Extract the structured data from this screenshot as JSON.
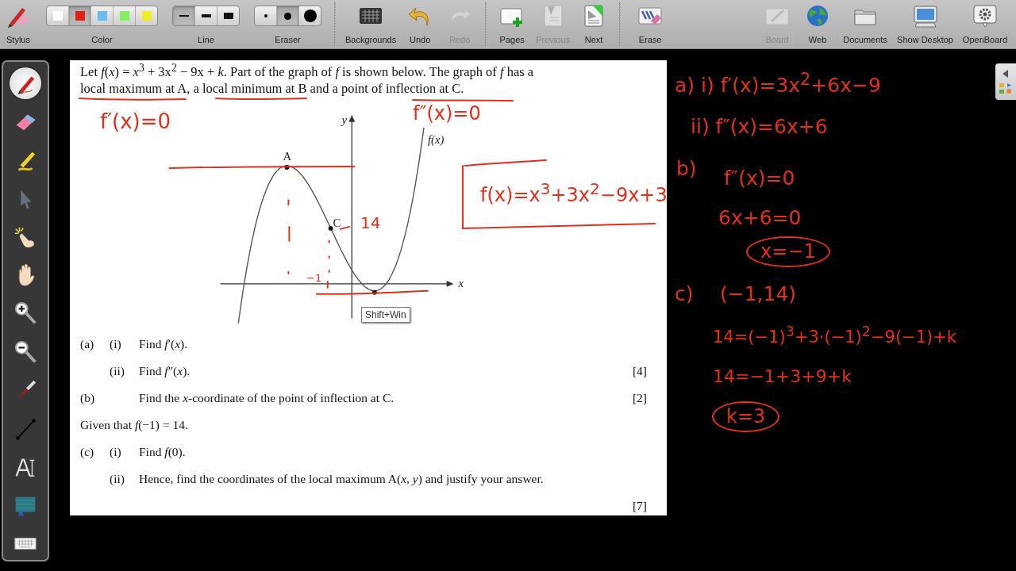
{
  "toolbar": {
    "left_items": [
      {
        "kind": "stylus",
        "label": "Stylus",
        "disabled": false
      },
      {
        "kind": "colors",
        "label": "Color",
        "disabled": false,
        "options": [
          {
            "color": "#ffffff",
            "selected": false
          },
          {
            "color": "#e02010",
            "selected": true
          },
          {
            "color": "#6cbcf4",
            "selected": false
          },
          {
            "color": "#80f060",
            "selected": false
          },
          {
            "color": "#f0f020",
            "selected": false
          }
        ]
      },
      {
        "kind": "line",
        "label": "Line",
        "disabled": false,
        "options": [
          {
            "selected": true
          },
          {
            "selected": false
          },
          {
            "selected": false
          }
        ]
      },
      {
        "kind": "eraser",
        "label": "Eraser",
        "disabled": false,
        "options": [
          {
            "selected": false
          },
          {
            "selected": true
          },
          {
            "selected": false
          }
        ]
      },
      {
        "kind": "backgrounds",
        "label": "Backgrounds",
        "disabled": false
      },
      {
        "kind": "undo",
        "label": "Undo",
        "disabled": false
      },
      {
        "kind": "redo",
        "label": "Redo",
        "disabled": true
      },
      {
        "kind": "pages",
        "label": "Pages",
        "disabled": false
      },
      {
        "kind": "previous",
        "label": "Previous",
        "disabled": true
      },
      {
        "kind": "next",
        "label": "Next",
        "disabled": false
      },
      {
        "kind": "erase",
        "label": "Erase",
        "disabled": false
      }
    ],
    "right_items": [
      {
        "kind": "board",
        "label": "Board",
        "disabled": true
      },
      {
        "kind": "web",
        "label": "Web",
        "disabled": false
      },
      {
        "kind": "documents",
        "label": "Documents",
        "disabled": false
      },
      {
        "kind": "desktop",
        "label": "Show Desktop",
        "disabled": false
      },
      {
        "kind": "openboard",
        "label": "OpenBoard",
        "disabled": false
      }
    ]
  },
  "tools": [
    {
      "kind": "pen",
      "selected": true
    },
    {
      "kind": "eraser",
      "selected": false
    },
    {
      "kind": "marker",
      "selected": false
    },
    {
      "kind": "selector",
      "selected": false
    },
    {
      "kind": "laser",
      "selected": false
    },
    {
      "kind": "hand",
      "selected": false
    },
    {
      "kind": "zoom_in",
      "selected": false
    },
    {
      "kind": "zoom_out",
      "selected": false
    },
    {
      "kind": "pointer",
      "selected": false
    },
    {
      "kind": "line",
      "selected": false
    },
    {
      "kind": "text",
      "selected": false
    },
    {
      "kind": "capture",
      "selected": false
    },
    {
      "kind": "keyboard",
      "selected": false
    }
  ],
  "document": {
    "intro": "Let *f*(*x*) = *x*$^{3}$ + 3x$^{2}$ − 9x + *k*. Part of the graph of *f* is shown below. The graph of *f* has a local maximum at A, a local minimum at B and a point of inflection at C.",
    "graph_labels": [
      "y",
      "x",
      "f(x)",
      "A",
      "C"
    ],
    "ink": [
      "f′(x)=0",
      "f″(x)=0",
      "−1",
      "14",
      "f(x)=x$^{3}$+3x$^{2}$−9x+3"
    ],
    "tooltip": "Shift+Win",
    "questions": [
      {
        "kind": "question",
        "part": "(a)",
        "sub": "(i)",
        "text": "Find *f*′(*x*)."
      },
      {
        "kind": "question",
        "sub": "(ii)",
        "text": "Find *f*″(*x*).",
        "marks": "[4]"
      },
      {
        "kind": "question",
        "part": "(b)",
        "text": "Find the *x*-coordinate of the point of inflection at C.",
        "marks": "[2]"
      },
      {
        "kind": "statement",
        "text": "Given that *f*(−1) = 14."
      },
      {
        "kind": "question",
        "part": "(c)",
        "sub": "(i)",
        "text": "Find *f*(0)."
      },
      {
        "kind": "question",
        "sub": "(ii)",
        "text": "Hence, find the coordinates of the local maximum A(*x*, *y*) and justify your answer."
      },
      {
        "kind": "marks",
        "marks": "[7]"
      }
    ]
  },
  "annotations": [
    {
      "kind": "text",
      "text": "a) i) f′(x)=3x$^{2}$+6x−9"
    },
    {
      "kind": "text",
      "text": "ii) f″(x)=6x+6"
    },
    {
      "kind": "text",
      "text": "b)"
    },
    {
      "kind": "text",
      "text": "f″(x)=0"
    },
    {
      "kind": "text",
      "text": "6x+6=0"
    },
    {
      "kind": "circled",
      "text": "x=−1"
    },
    {
      "kind": "text",
      "text": "c)"
    },
    {
      "kind": "text",
      "text": "(−1,14)"
    },
    {
      "kind": "text",
      "text": "14=(−1)$^{3}$+3·(−1)$^{2}$−9(−1)+k"
    },
    {
      "kind": "text",
      "text": "14=−1+3+9+k"
    },
    {
      "kind": "circled",
      "text": "k=3"
    }
  ]
}
